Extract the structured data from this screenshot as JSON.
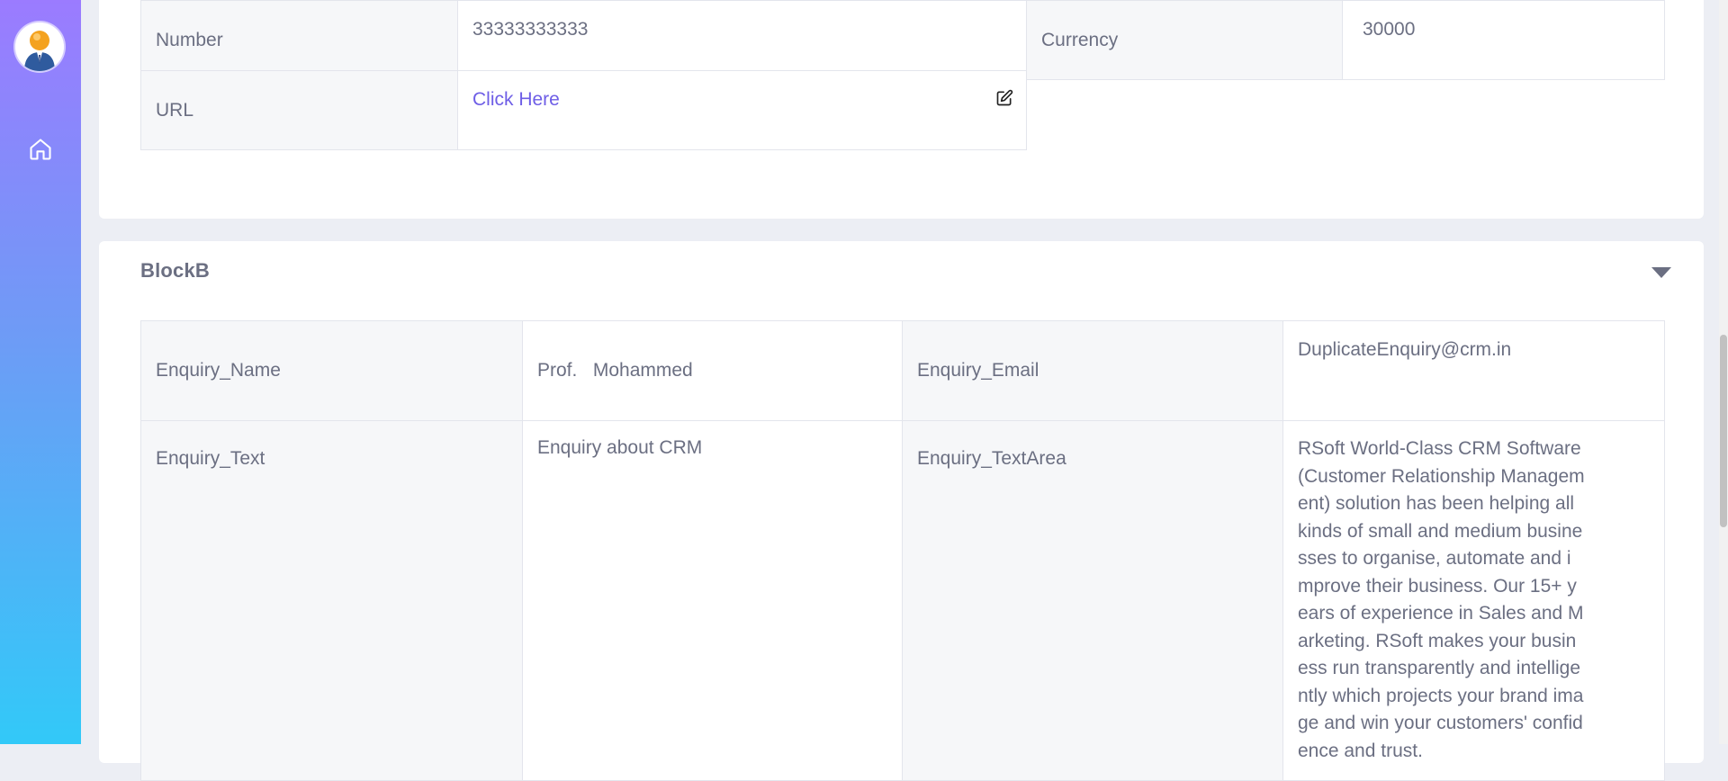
{
  "sidebar": {
    "avatar_icon": "user-avatar-icon",
    "nav_items": [
      {
        "icon": "home-icon",
        "label": "Home"
      }
    ]
  },
  "block_a": {
    "rows": [
      {
        "label_1": "Number",
        "value_1": "33333333333",
        "label_2": "Currency",
        "value_2": "30000"
      },
      {
        "label_1": "URL",
        "value_1": "Click Here",
        "value_1_icon": "edit-icon"
      }
    ]
  },
  "block_b": {
    "title": "BlockB",
    "toggle_icon": "caret-down-icon",
    "rows": [
      {
        "label_1": "Enquiry_Name",
        "value_1": "Prof.   Mohammed",
        "label_2": "Enquiry_Email",
        "value_2": "DuplicateEnquiry@crm.in"
      },
      {
        "label_1": "Enquiry_Text",
        "value_1": "Enquiry about CRM",
        "label_2": "Enquiry_TextArea",
        "value_2": "RSoft World-Class CRM Software (Customer Relationship Management) solution has been helping all kinds of small and medium businesses to organise, automate and improve their business. Our 15+ years of experience in Sales and Marketing. RSoft makes your business run transparently and intelligently which projects your brand image and win your customers' confidence and trust."
      }
    ]
  },
  "colors": {
    "sidebar_top": "#9b7bff",
    "sidebar_bottom": "#32c9f8",
    "link": "#6e5ee6",
    "label_bg": "#f6f7f9",
    "text": "#6b6f82"
  }
}
